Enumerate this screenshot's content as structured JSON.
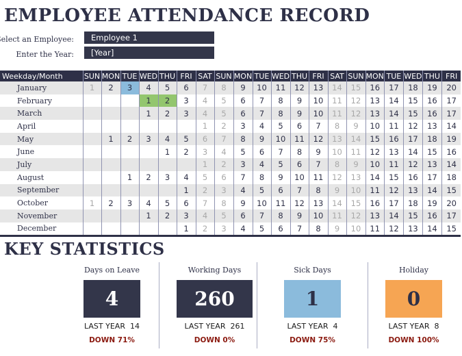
{
  "title": "EMPLOYEE ATTENDANCE RECORD",
  "form": {
    "employee_label": "Select an Employee:",
    "employee_value": "Employee 1",
    "year_label": "Enter the Year:",
    "year_value": "[Year]"
  },
  "calendar": {
    "header_label": "Weekday/Month",
    "weekdays": [
      "SUN",
      "MON",
      "TUE",
      "WED",
      "THU",
      "FRI",
      "SAT",
      "SUN",
      "MON",
      "TUE",
      "WED",
      "THU",
      "FRI",
      "SAT",
      "SUN",
      "MON",
      "TUE",
      "WED",
      "THU",
      "FRI"
    ],
    "months": [
      {
        "name": "January",
        "start": 0,
        "cells": [
          1,
          2,
          3,
          4,
          5,
          6,
          7,
          8,
          9,
          10,
          11,
          12,
          13,
          14,
          15,
          16,
          17,
          18,
          19,
          20
        ]
      },
      {
        "name": "February",
        "start": 3,
        "cells": [
          1,
          2,
          3,
          4,
          5,
          6,
          7,
          8,
          9,
          10,
          11,
          12,
          13,
          14,
          15,
          16,
          17
        ]
      },
      {
        "name": "March",
        "start": 3,
        "cells": [
          1,
          2,
          3,
          4,
          5,
          6,
          7,
          8,
          9,
          10,
          11,
          12,
          13,
          14,
          15,
          16,
          17
        ]
      },
      {
        "name": "April",
        "start": 6,
        "cells": [
          1,
          2,
          3,
          4,
          5,
          6,
          7,
          8,
          9,
          10,
          11,
          12,
          13,
          14
        ]
      },
      {
        "name": "May",
        "start": 1,
        "cells": [
          1,
          2,
          3,
          4,
          5,
          6,
          7,
          8,
          9,
          10,
          11,
          12,
          13,
          14,
          15,
          16,
          17,
          18,
          19
        ]
      },
      {
        "name": "June",
        "start": 4,
        "cells": [
          1,
          2,
          3,
          4,
          5,
          6,
          7,
          8,
          9,
          10,
          11,
          12,
          13,
          14,
          15,
          16
        ]
      },
      {
        "name": "July",
        "start": 6,
        "cells": [
          1,
          2,
          3,
          4,
          5,
          6,
          7,
          8,
          9,
          10,
          11,
          12,
          13,
          14
        ]
      },
      {
        "name": "August",
        "start": 2,
        "cells": [
          1,
          2,
          3,
          4,
          5,
          6,
          7,
          8,
          9,
          10,
          11,
          12,
          13,
          14,
          15,
          16,
          17,
          18
        ]
      },
      {
        "name": "September",
        "start": 5,
        "cells": [
          1,
          2,
          3,
          4,
          5,
          6,
          7,
          8,
          9,
          10,
          11,
          12,
          13,
          14,
          15
        ]
      },
      {
        "name": "October",
        "start": 0,
        "cells": [
          1,
          2,
          3,
          4,
          5,
          6,
          7,
          8,
          9,
          10,
          11,
          12,
          13,
          14,
          15,
          16,
          17,
          18,
          19,
          20
        ]
      },
      {
        "name": "November",
        "start": 3,
        "cells": [
          1,
          2,
          3,
          4,
          5,
          6,
          7,
          8,
          9,
          10,
          11,
          12,
          13,
          14,
          15,
          16,
          17
        ]
      },
      {
        "name": "December",
        "start": 5,
        "cells": [
          1,
          2,
          3,
          4,
          5,
          6,
          7,
          8,
          9,
          10,
          11,
          12,
          13,
          14,
          15
        ]
      }
    ],
    "marks": [
      {
        "month": "January",
        "day": 3,
        "type": "sick"
      },
      {
        "month": "February",
        "day": 1,
        "type": "leave"
      },
      {
        "month": "February",
        "day": 2,
        "type": "leave"
      }
    ],
    "colors": {
      "sick": "#8bbbdc",
      "leave": "#93c66e",
      "header": "#2e3047",
      "weekend_text": "#a8a8a8"
    }
  },
  "stats": {
    "heading": "KEY STATISTICS",
    "cards": [
      {
        "label": "Days on Leave",
        "value": "4",
        "last_year_label": "LAST YEAR",
        "last_year": "14",
        "change": "DOWN 71%",
        "bg": "#33364a",
        "fg": "#ffffff"
      },
      {
        "label": "Working Days",
        "value": "260",
        "last_year_label": "LAST YEAR",
        "last_year": "261",
        "change": "DOWN 0%",
        "bg": "#33364a",
        "fg": "#ffffff"
      },
      {
        "label": "Sick Days",
        "value": "1",
        "last_year_label": "LAST YEAR",
        "last_year": "4",
        "change": "DOWN 75%",
        "bg": "#8bbbdc",
        "fg": "#2e3047"
      },
      {
        "label": "Holiday",
        "value": "0",
        "last_year_label": "LAST YEAR",
        "last_year": "8",
        "change": "DOWN 100%",
        "bg": "#f6a553",
        "fg": "#2e3047"
      }
    ]
  }
}
